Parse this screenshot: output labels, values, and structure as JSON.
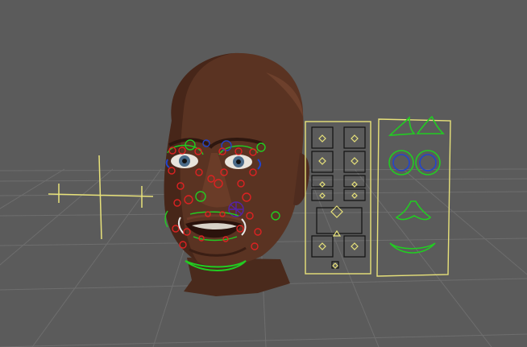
{
  "viewport": {
    "kind": "3d-viewport",
    "background_color": "#5b5b5b",
    "grid_color": "#6e6e6e",
    "control_color_yellow": "#e8e27a",
    "control_color_green": "#22cc22",
    "control_color_red": "#dd2222",
    "control_color_blue": "#2244cc",
    "control_color_purple": "#5522aa"
  },
  "model": {
    "name_icon": "head-mesh",
    "skin_color": "#5a3322"
  },
  "controls": {
    "eyebrow_left": "eyebrow-control",
    "eyebrow_right": "eyebrow-control",
    "jaw": "jaw-control",
    "eye_target": "eye-aim-locator"
  },
  "panels": {
    "ui_panel_left": "facial-slider-panel",
    "ui_panel_right": "facial-shape-panel"
  }
}
